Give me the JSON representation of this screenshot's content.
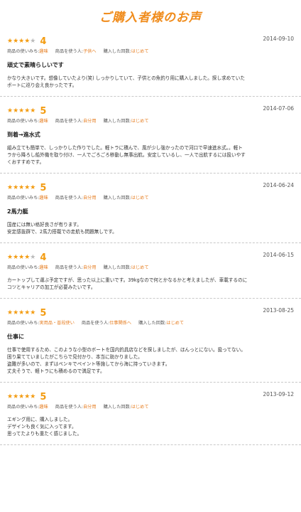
{
  "page": {
    "title": "ご購入者様のお声"
  },
  "colors": {
    "accent": "#f08c1c",
    "star": "#f39c12",
    "star_off": "#bbbbbb",
    "divider": "#c8c8c8"
  },
  "reviews": [
    {
      "stars": 4,
      "stars_filled": "★★★★",
      "stars_empty": "★",
      "rating": "4",
      "date": "2014-09-10",
      "usage_label": "商品の使いみち:",
      "usage": "趣味",
      "user_label": "商品を使う人:",
      "user": "子供へ",
      "count_label": "購入した回数:",
      "count": "はじめて",
      "headline": "頑丈で素晴らしいです",
      "body": [
        "かなり大きいです。想像していたより(笑) しっかりしていて、子供との魚釣り用に購入しました。探し求めていた",
        "ボートに巡り会え良かったです。"
      ]
    },
    {
      "stars": 5,
      "stars_filled": "★★★★★",
      "stars_empty": "",
      "rating": "5",
      "date": "2014-07-06",
      "usage_label": "商品の使いみち:",
      "usage": "趣味",
      "user_label": "商品を使う人:",
      "user": "自分用",
      "count_label": "購入した回数:",
      "count": "はじめて",
      "headline": "到着→進水式",
      "body": [
        "組み立ても簡単で、しっかりした作りでした。軽トラに積んで、風が少し強かったので河口で早速進水式。。軽ト",
        "ラから降ろし船外機を取り付け、一人でごろごろ移動し無事出航。安定しているし、一人で出航するには扱いやす",
        "くおすすめです。"
      ]
    },
    {
      "stars": 5,
      "stars_filled": "★★★★★",
      "stars_empty": "",
      "rating": "5",
      "date": "2014-06-24",
      "usage_label": "商品の使いみち:",
      "usage": "趣味",
      "user_label": "商品を使う人:",
      "user": "自分用",
      "count_label": "購入した回数:",
      "count": "はじめて",
      "headline": "2馬力艇",
      "body": [
        "国産には無い格好良さが有ります。",
        "安定感抜群で、2馬力搭載での走航も問題無しです。"
      ]
    },
    {
      "stars": 4,
      "stars_filled": "★★★★",
      "stars_empty": "★",
      "rating": "4",
      "date": "2014-06-15",
      "usage_label": "商品の使いみち:",
      "usage": "趣味",
      "user_label": "商品を使う人:",
      "user": "自分用",
      "count_label": "購入した回数:",
      "count": "はじめて",
      "headline": "",
      "body": [
        "カートップして運ぶ予定ですが、思った以上に重いです。39kgなので何とかなるかと考えましたが、車載するのに",
        "コツとキャリアの加工が必要みたいです。"
      ]
    },
    {
      "stars": 5,
      "stars_filled": "★★★★★",
      "stars_empty": "",
      "rating": "5",
      "date": "2013-08-25",
      "usage_label": "商品の使いみち:",
      "usage": "実用品・普段使い",
      "user_label": "商品を使う人:",
      "user": "仕事関係へ",
      "count_label": "購入した回数:",
      "count": "はじめて",
      "headline": "仕事に",
      "body": [
        "仕事で使用するため、このような小型のボートを国内釣具店などを探しましたが、ほんっとにない。扱ってない。",
        "困り果てていましたがこちらで見付かり、本当に助かりました。",
        "盗難が多いので、まずはペンキでペイント等施してから海に持っていきます。",
        "丈夫そうで、軽トラにも積めるので満足です。"
      ]
    },
    {
      "stars": 5,
      "stars_filled": "★★★★★",
      "stars_empty": "",
      "rating": "5",
      "date": "2013-09-12",
      "usage_label": "商品の使いみち:",
      "usage": "趣味",
      "user_label": "商品を使う人:",
      "user": "自分用",
      "count_label": "購入した回数:",
      "count": "はじめて",
      "headline": "",
      "body": [
        "エギング用に、購入しました。",
        "デザインも良く気に入ってます。",
        "思ってたよりも重たく感じました。"
      ]
    }
  ]
}
